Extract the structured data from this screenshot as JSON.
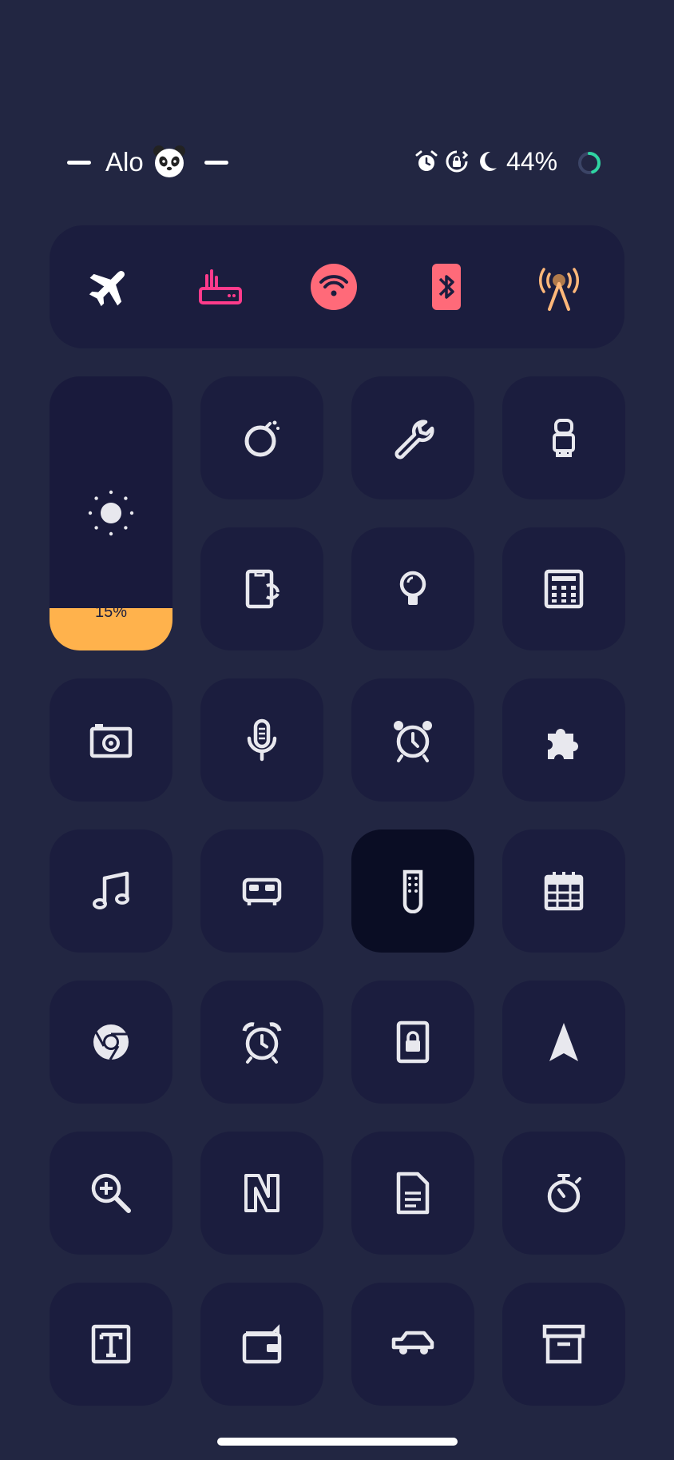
{
  "status_bar": {
    "title": "Alo",
    "battery": "44%",
    "battery_level": 0.44
  },
  "connectivity": [
    {
      "name": "airplane-icon",
      "color": "#ffffff"
    },
    {
      "name": "hotspot-router-icon",
      "color": "#ff3b8b"
    },
    {
      "name": "wifi-icon",
      "color": "#ff6a79"
    },
    {
      "name": "bluetooth-icon",
      "color": "#ff6a79"
    },
    {
      "name": "broadcast-tower-icon",
      "color": "#ffb87a"
    }
  ],
  "brightness": {
    "value_text": "15%",
    "level": 0.15,
    "color": "#ffb24c"
  },
  "tiles": [
    "bomb-icon",
    "wrench-icon",
    "astronaut-icon",
    "screen-rotate-icon",
    "lightbulb-icon",
    "calculator-icon",
    "camera-icon",
    "microphone-icon",
    "alarm-clock-icon",
    "puzzle-icon",
    "music-icon",
    "bed-icon",
    "remote-icon",
    "calendar-icon",
    "chrome-icon",
    "alarm-icon",
    "lock-document-icon",
    "navigation-arrow-icon",
    "zoom-in-icon",
    "notion-icon",
    "document-icon",
    "stopwatch-icon",
    "text-box-icon",
    "wallet-icon",
    "car-icon",
    "archive-icon"
  ]
}
